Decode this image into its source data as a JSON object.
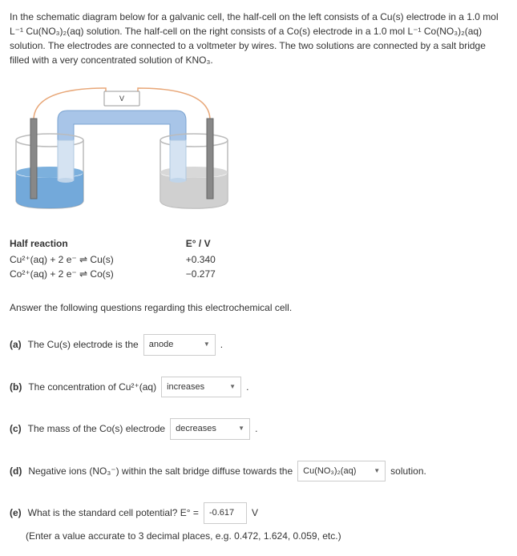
{
  "intro": {
    "text": "In the schematic diagram below for a galvanic cell, the half-cell on the left consists of a Cu(s) electrode in a 1.0 mol L⁻¹ Cu(NO₃)₂(aq) solution.  The half-cell on the right consists of a Co(s) electrode in a 1.0 mol L⁻¹ Co(NO₃)₂(aq) solution. The electrodes are connected to a voltmeter by wires. The two solutions are connected by a salt bridge filled with a very concentrated solution of KNO₃."
  },
  "voltmeter_label": "V",
  "table": {
    "header_left": "Half reaction",
    "header_right": "E° / V",
    "rows": [
      {
        "reaction": "Cu²⁺(aq) + 2 e⁻ ⇌ Cu(s)",
        "potential": "+0.340"
      },
      {
        "reaction": "Co²⁺(aq) + 2 e⁻ ⇌ Co(s)",
        "potential": "−0.277"
      }
    ]
  },
  "prompt": "Answer the following questions regarding this electrochemical cell.",
  "qa": {
    "label": "(a)",
    "text_before": "The Cu(s) electrode is the",
    "value": "anode",
    "period": "."
  },
  "qb": {
    "label": "(b)",
    "text_before": "The concentration of Cu²⁺(aq)",
    "value": "increases",
    "period": "."
  },
  "qc": {
    "label": "(c)",
    "text_before": "The mass of the Co(s) electrode",
    "value": "decreases",
    "period": "."
  },
  "qd": {
    "label": "(d)",
    "text_before": "Negative ions (NO₃⁻) within the salt bridge diffuse towards the",
    "value": "Cu(NO₃)₂(aq)",
    "text_after": "solution."
  },
  "qe": {
    "label": "(e)",
    "text_before": "What is the standard cell potential?  E° =",
    "value": "-0.617",
    "unit": "V",
    "note": "(Enter a value accurate to 3 decimal places, e.g. 0.472, 1.624, 0.059, etc.)"
  }
}
